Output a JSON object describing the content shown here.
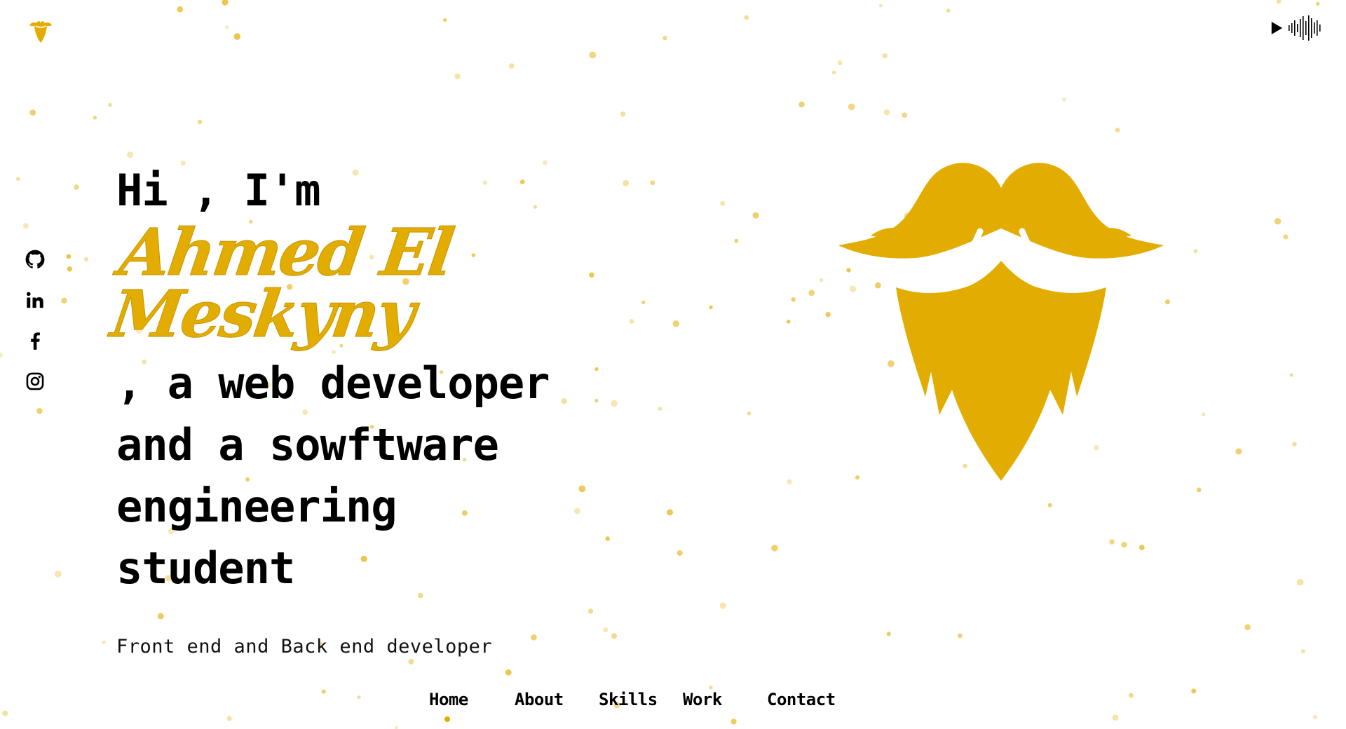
{
  "colors": {
    "accent": "#e2ad00",
    "text": "#000000",
    "background": "#ffffff"
  },
  "header": {
    "logo_icon": "beard-logo-icon",
    "audio_icons": [
      "play-icon",
      "sound-wave-icon"
    ]
  },
  "social": {
    "items": [
      {
        "name": "github",
        "icon": "github-icon"
      },
      {
        "name": "linkedin",
        "icon": "linkedin-icon"
      },
      {
        "name": "facebook",
        "icon": "facebook-icon"
      },
      {
        "name": "instagram",
        "icon": "instagram-icon"
      }
    ]
  },
  "hero": {
    "greeting": "Hi , I'm ",
    "name": "Ahmed El Meskyny",
    "line_after_name": " , a web developer",
    "line_3": "and a sowftware engineering",
    "line_4": "student",
    "subtitle": "Front end and Back end developer",
    "illustration_icon": "beard-mustache-icon"
  },
  "nav": {
    "items": [
      {
        "label": "Home",
        "active": true
      },
      {
        "label": "About",
        "active": false
      },
      {
        "label": "Skills",
        "active": false
      },
      {
        "label": "Work",
        "active": false
      },
      {
        "label": "Contact",
        "active": false
      }
    ]
  }
}
